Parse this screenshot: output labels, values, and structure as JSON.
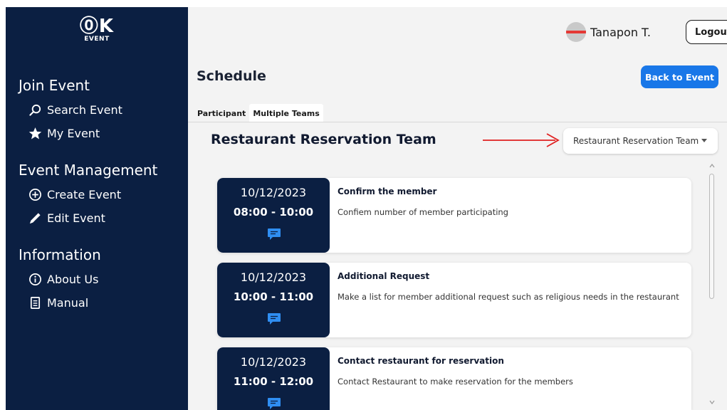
{
  "sidebar": {
    "logo": {
      "mark": "⓪K",
      "sub": "EVENT"
    },
    "sections": [
      {
        "title": "Join Event",
        "items": [
          {
            "label": "Search Event",
            "icon": "search-icon"
          },
          {
            "label": "My Event",
            "icon": "star-icon"
          }
        ]
      },
      {
        "title": "Event Management",
        "items": [
          {
            "label": "Create Event",
            "icon": "plus-circle-icon"
          },
          {
            "label": "Edit Event",
            "icon": "pencil-icon"
          }
        ]
      },
      {
        "title": "Information",
        "items": [
          {
            "label": "About Us",
            "icon": "info-icon"
          },
          {
            "label": "Manual",
            "icon": "document-icon"
          }
        ]
      }
    ]
  },
  "header": {
    "user_name": "Tanapon T.",
    "logout_label": "Logout"
  },
  "page": {
    "title": "Schedule",
    "back_label": "Back to Event",
    "tabs": [
      {
        "label": "Participant",
        "active": false
      },
      {
        "label": "Multiple Teams",
        "active": true
      }
    ],
    "team_title": "Restaurant Reservation Team",
    "team_select": {
      "selected": "Restaurant Reservation Team"
    }
  },
  "schedule": [
    {
      "date": "10/12/2023",
      "time": "08:00 - 10:00",
      "title": "Confirm the member",
      "description": "Confiem number of member participating"
    },
    {
      "date": "10/12/2023",
      "time": "10:00 - 11:00",
      "title": "Additional Request",
      "description": "Make a list for member additional request such as religious needs in the restaurant"
    },
    {
      "date": "10/12/2023",
      "time": "11:00 - 12:00",
      "title": "Contact restaurant for reservation",
      "description": "Contact Restaurant to make reservation for the  members"
    }
  ],
  "colors": {
    "sidebar_bg": "#0b1f42",
    "accent_blue": "#1977e8",
    "chat_icon": "#2f8ef2",
    "annotation_arrow": "#e02020"
  }
}
